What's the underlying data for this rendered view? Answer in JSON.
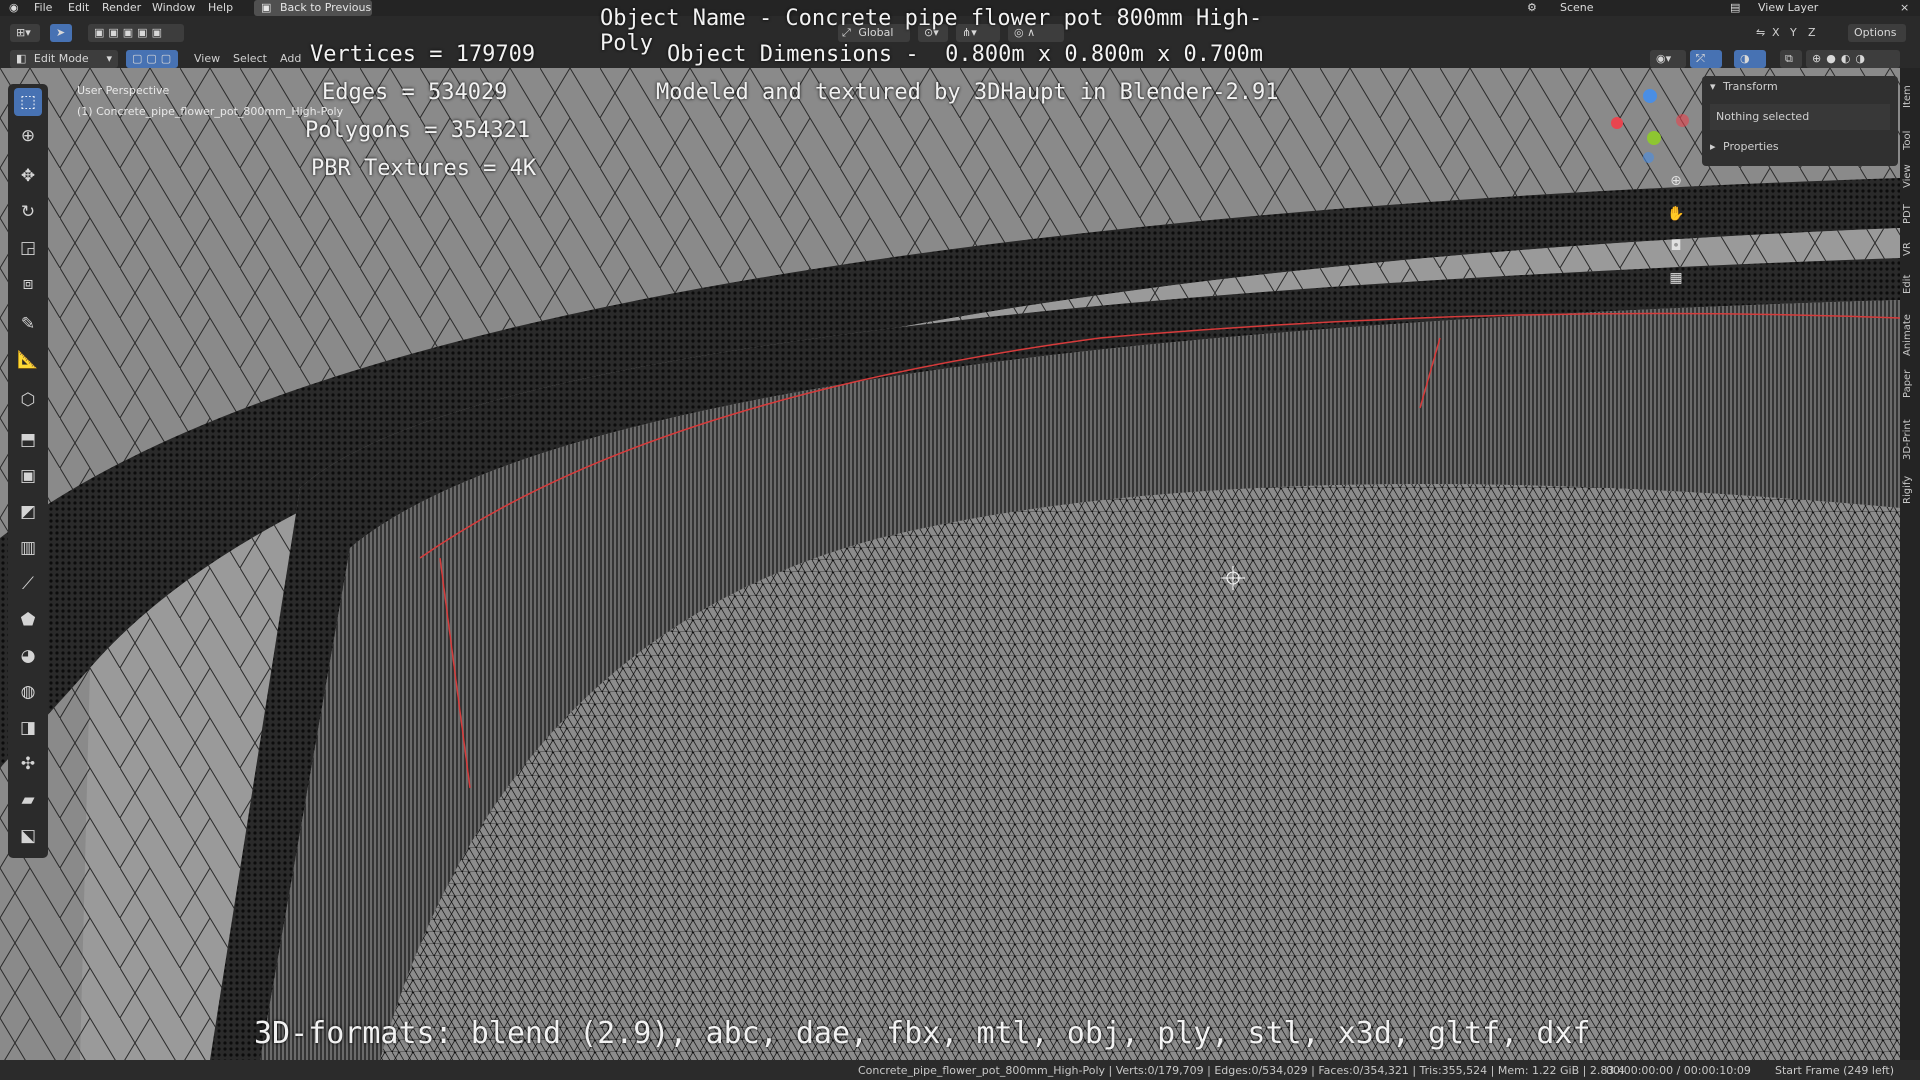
{
  "menu": {
    "file": "File",
    "edit": "Edit",
    "render": "Render",
    "window": "Window",
    "help": "Help",
    "back_to_previous": "Back to Previous",
    "scene": "Scene",
    "view_layer": "View Layer"
  },
  "header": {
    "mode": "Edit Mode",
    "view": "View",
    "select": "Select",
    "add": "Add",
    "transform_orientation": "Global",
    "options": "Options",
    "axes": [
      "X",
      "Y",
      "Z"
    ]
  },
  "viewport": {
    "perspective_label": "User Perspective",
    "object_label": "(1) Concrete_pipe_flower_pot_800mm_High-Poly"
  },
  "overlay": {
    "vertices": "Vertices = 179709",
    "edges": "Edges = 534029",
    "polygons": "Polygons = 354321",
    "textures": "PBR Textures = 4K",
    "object_name": "Object Name - Concrete pipe flower pot 800mm High-Poly",
    "object_dimensions": "Object Dimensions -  0.800m x 0.800m x 0.700m",
    "credit": "Modeled and textured by 3DHaupt in Blender-2.91",
    "formats": "3D-formats: blend (2.9), abc, dae, fbx, mtl, obj, ply, stl, x3d, gltf, dxf"
  },
  "npanel": {
    "transform": "Transform",
    "nothing_selected": "Nothing selected",
    "properties": "Properties"
  },
  "sidebar_tabs": [
    "Item",
    "Tool",
    "View",
    "PDT",
    "VR",
    "Edit",
    "Animate",
    "Paper",
    "3D-Print",
    "Rigify"
  ],
  "statusbar": {
    "stats": "Concrete_pipe_flower_pot_800mm_High-Poly | Verts:0/179,709 | Edges:0/534,029 | Faces:0/354,321 | Tris:355,524 | Mem: 1.22 GiB | 2.83.4",
    "timecode": "00:00:00:00 / 00:00:10:09",
    "start_frame": "Start Frame (249 left)"
  },
  "colors": {
    "active_tool": "#4772b3",
    "axis_x": "#e8454f",
    "axis_y": "#8ec631",
    "axis_z": "#4a8ee4",
    "seam": "#d63b3b"
  }
}
